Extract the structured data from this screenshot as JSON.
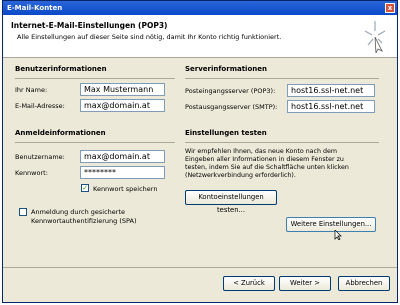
{
  "window": {
    "title": "E-Mail-Konten",
    "close_glyph": "x"
  },
  "header": {
    "title": "Internet-E-Mail-Einstellungen (POP3)",
    "subtitle": "Alle Einstellungen auf dieser Seite sind nötig, damit Ihr Konto richtig funktioniert."
  },
  "user_info": {
    "heading": "Benutzerinformationen",
    "name_label": "Ihr Name:",
    "name_value": "Max Mustermann",
    "email_label": "E-Mail-Adresse:",
    "email_value": "max@domain.at"
  },
  "server_info": {
    "heading": "Serverinformationen",
    "incoming_label": "Posteingangsserver (POP3):",
    "incoming_value": "host16.ssl-net.net",
    "outgoing_label": "Postausgangsserver (SMTP):",
    "outgoing_value": "host16.ssl-net.net"
  },
  "login_info": {
    "heading": "Anmeldeinformationen",
    "username_label": "Benutzername:",
    "username_value": "max@domain.at",
    "password_label": "Kennwort:",
    "password_value": "********",
    "remember_label": "Kennwort speichern",
    "remember_checked": true,
    "spa_label_line1": "Anmeldung durch gesicherte",
    "spa_label_line2": "Kennwortauthentifizierung (SPA)",
    "spa_checked": false
  },
  "test_settings": {
    "heading": "Einstellungen testen",
    "text_line1": "Wir empfehlen Ihnen, das neue Konto nach dem",
    "text_line2": "Eingeben aller Informationen in diesem Fenster zu",
    "text_line3": "testen, indem Sie auf die Schaltfläche unten klicken",
    "text_line4": "(Netzwerkverbindung erforderlich).",
    "test_button": "Kontoeinstellungen testen...",
    "more_button": "Weitere Einstellungen..."
  },
  "footer": {
    "back": "< Zurück",
    "next": "Weiter >",
    "cancel": "Abbrechen"
  },
  "colors": {
    "titlebar": "#0a48c8",
    "dialog_bg": "#ece9d8",
    "check": "#21a121"
  }
}
